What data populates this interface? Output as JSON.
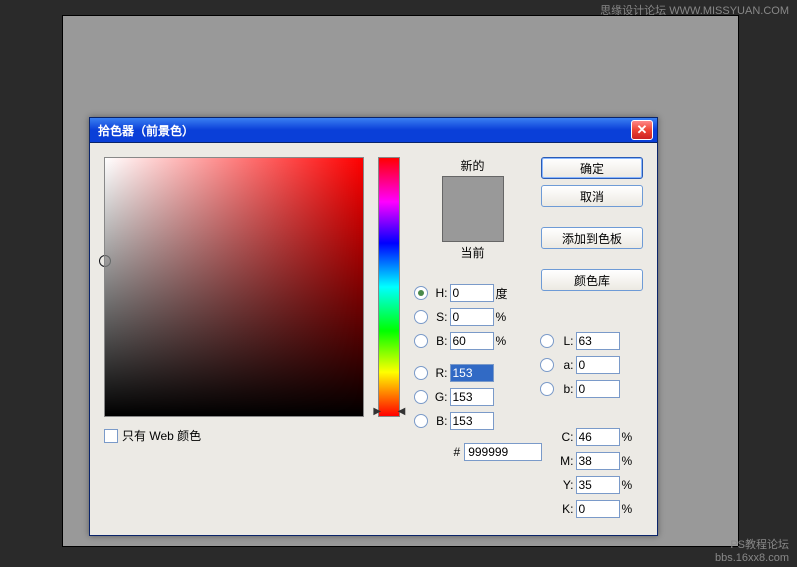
{
  "watermark_top": "思缘设计论坛  WWW.MISSYUAN.COM",
  "watermark_bot1": "PS教程论坛",
  "watermark_bot2": "bbs.16xx8.com",
  "dialog": {
    "title": "拾色器（前景色）",
    "new_label": "新的",
    "current_label": "当前",
    "only_web_label": "只有 Web 颜色",
    "buttons": {
      "ok": "确定",
      "cancel": "取消",
      "add": "添加到色板",
      "lib": "颜色库"
    },
    "hsb": {
      "h": "0",
      "h_unit": "度",
      "s": "0",
      "s_unit": "%",
      "b": "60",
      "b_unit": "%"
    },
    "rgb": {
      "r": "153",
      "g": "153",
      "b": "153"
    },
    "lab": {
      "l": "63",
      "a": "0",
      "b": "0"
    },
    "cmyk": {
      "c": "46",
      "m": "38",
      "y": "35",
      "k": "0"
    },
    "hex": "999999",
    "swatch_new": "#999999",
    "swatch_cur": "#999999"
  }
}
